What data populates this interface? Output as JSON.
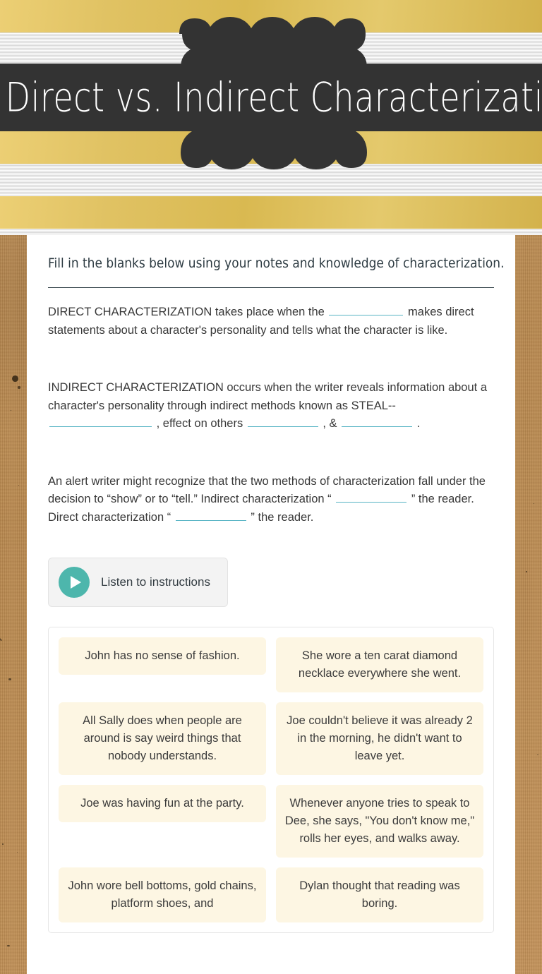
{
  "header": {
    "title": "Direct vs. Indirect Characterization",
    "badge_color": "#333333",
    "stripe_gold": "#e0c263",
    "stripe_white": "#e9e9e9"
  },
  "worksheet": {
    "instructions": "Fill in the blanks below using your notes and knowledge of characterization.",
    "paragraphs": {
      "p1_a": "DIRECT CHARACTERIZATION takes place when the",
      "p1_b": "makes direct statements about a character's personality and tells what the character is like.",
      "p2_a": "INDIRECT CHARACTERIZATION occurs when the writer reveals information about a character's personality through indirect methods known as STEAL--",
      "p2_b": ", effect on others",
      "p2_c": ", &",
      "p2_d": ".",
      "p3_a": "An alert writer might recognize that the two methods of characterization fall under the decision to “show” or to “tell.” Indirect characterization “",
      "p3_b": "” the reader. Direct characterization “",
      "p3_c": "” the reader."
    },
    "blank_color": "#56b3c4"
  },
  "listen_button": {
    "label": "Listen to instructions",
    "icon": "play-icon",
    "icon_color": "#4db6ac"
  },
  "answer_bank": {
    "card_color": "#fdf6e3",
    "cards": [
      "John has no sense of fashion.",
      "She wore a ten carat diamond necklace everywhere she went.",
      "All Sally does when people are around is say weird things that nobody understands.",
      "Joe couldn't believe it was already 2 in the morning, he didn't want to leave yet.",
      "Joe was having fun at the party.",
      "Whenever anyone tries to speak to Dee, she says, \"You don't know me,\" rolls her eyes, and walks away.",
      "John wore bell bottoms, gold chains, platform shoes, and",
      "Dylan thought that reading was boring."
    ]
  }
}
